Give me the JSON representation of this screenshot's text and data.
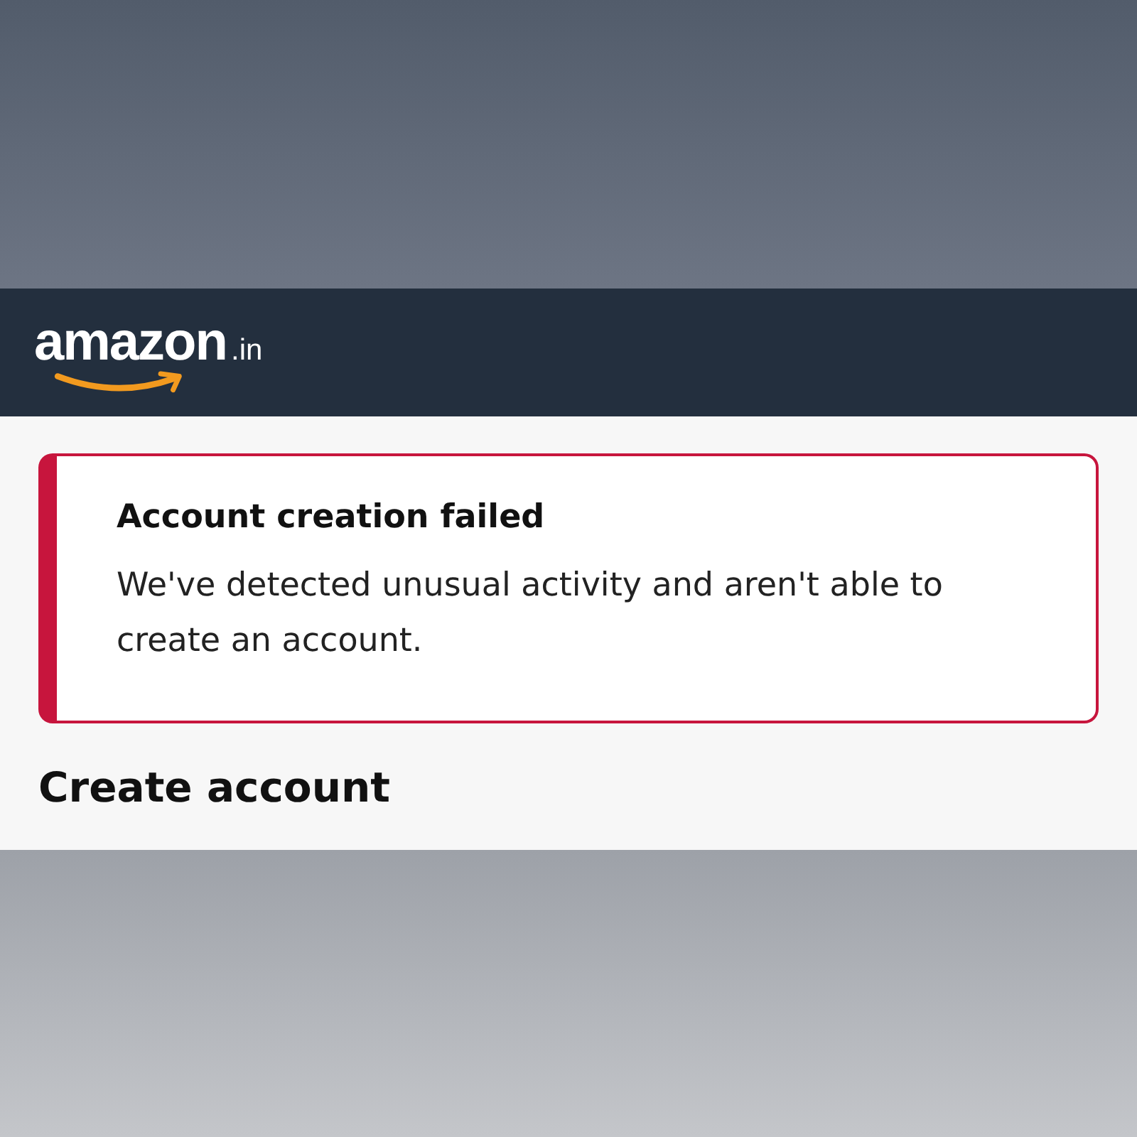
{
  "header": {
    "logo": {
      "word": "amazon",
      "suffix": ".in"
    }
  },
  "alert": {
    "kind": "error",
    "title": "Account creation failed",
    "message": "We've detected unusual activity and aren't able to create an account."
  },
  "heading": "Create account"
}
